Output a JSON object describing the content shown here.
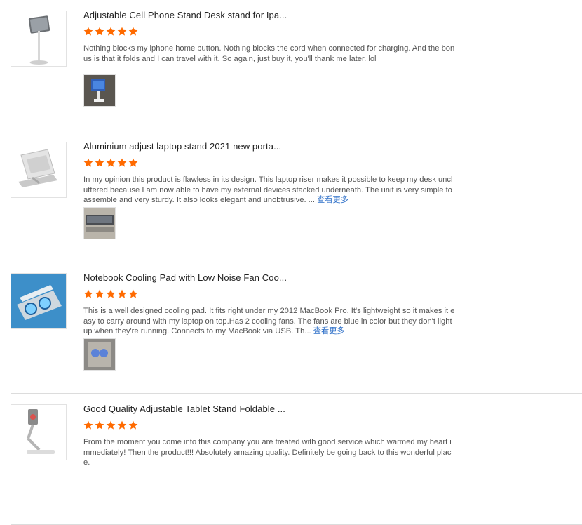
{
  "colors": {
    "star": "#ff6a00",
    "link": "#2d6fc8",
    "divider": "#dcdcdc"
  },
  "reviews": [
    {
      "title": "Adjustable Cell Phone Stand Desk stand for Ipa...",
      "rating": 5,
      "text": "Nothing blocks my iphone home button. Nothing blocks the cord when connected for charging. And the bonus is that it folds and I can travel with it. So again, just buy it, you'll thank me later. lol",
      "more": ""
    },
    {
      "title": "Aluminium adjust laptop stand 2021 new porta...",
      "rating": 5,
      "text": "In my opinion this product is flawless in its design. This laptop riser makes it possible to keep my desk uncluttered because I am now able to have my external devices stacked underneath. The unit is very simple to assemble and very sturdy. It also looks elegant and unobtrusive. ... ",
      "more": "查看更多"
    },
    {
      "title": "Notebook Cooling Pad with Low Noise Fan Coo...",
      "rating": 5,
      "text": "This is a well designed cooling pad. It fits right under my 2012 MacBook Pro. It's lightweight so it makes it easy to carry around with my laptop on top.Has 2 cooling fans. The fans are blue in color but they don't light up when they're running. Connects to my MacBook via USB. Th... ",
      "more": "查看更多"
    },
    {
      "title": "Good Quality Adjustable Tablet Stand Foldable ...",
      "rating": 5,
      "text": "From the moment you come into this company you are treated with good service which warmed my heart immediately! Then the product!!! Absolutely amazing quality. Definitely be going back to this wonderful place.",
      "more": ""
    }
  ]
}
